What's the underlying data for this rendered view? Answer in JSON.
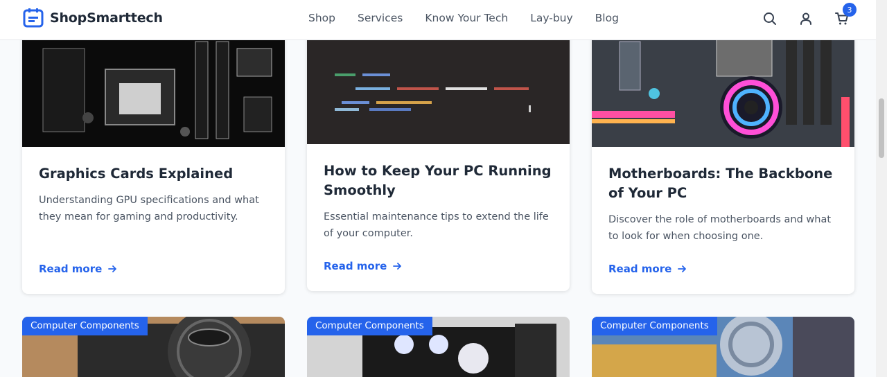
{
  "header": {
    "logo": "ShopSmarttech",
    "nav": [
      "Shop",
      "Services",
      "Know Your Tech",
      "Lay-buy",
      "Blog"
    ],
    "cart_count": "3",
    "icons": [
      "search-icon",
      "user-icon",
      "cart-icon"
    ]
  },
  "posts": [
    {
      "title": "Graphics Cards Explained",
      "description": "Understanding GPU specifications and what they mean for gaming and productivity.",
      "link": "Read more"
    },
    {
      "title": "How to Keep Your PC Running Smoothly",
      "description": "Essential maintenance tips to extend the life of your computer.",
      "link": "Read more"
    },
    {
      "title": "Motherboards: The Backbone of Your PC",
      "description": "Discover the role of motherboards and what to look for when choosing one.",
      "link": "Read more"
    }
  ],
  "next_row": [
    {
      "category": "Computer Components"
    },
    {
      "category": "Computer Components"
    },
    {
      "category": "Computer Components"
    }
  ],
  "colors": {
    "accent": "#2563eb",
    "text": "#1f2937",
    "muted": "#4b5563",
    "background": "#f8fafc"
  }
}
